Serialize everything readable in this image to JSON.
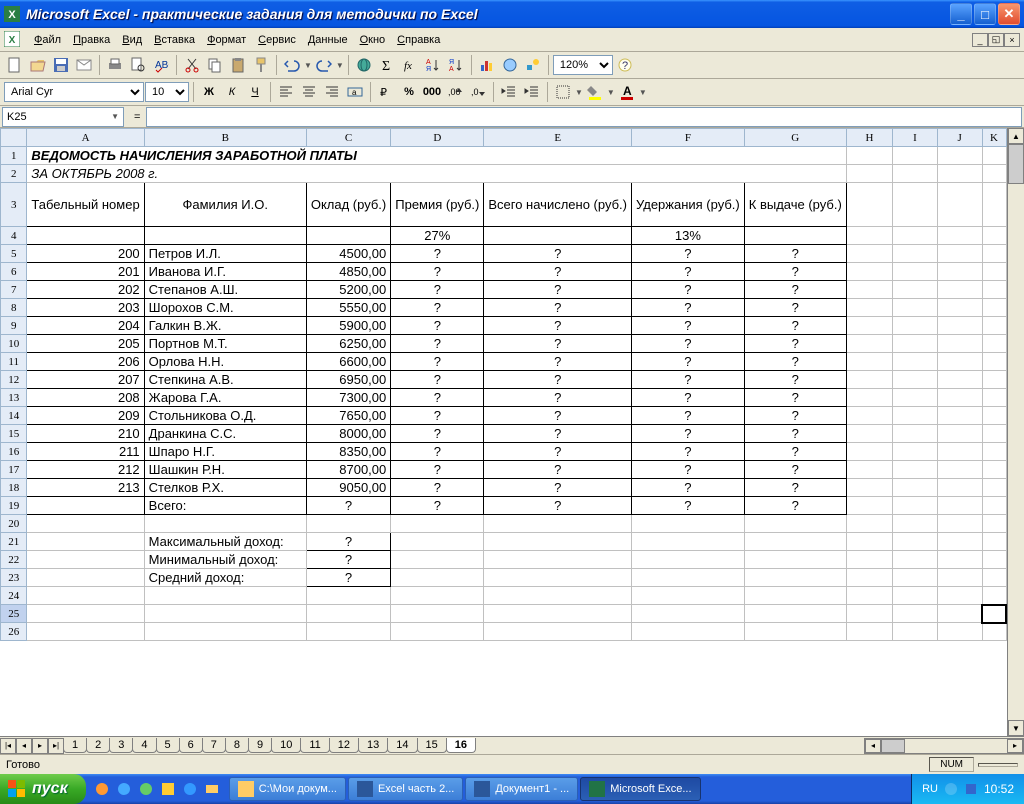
{
  "window": {
    "title": "Microsoft Excel - практические задания для методички по Excel"
  },
  "menu": [
    "Файл",
    "Правка",
    "Вид",
    "Вставка",
    "Формат",
    "Сервис",
    "Данные",
    "Окно",
    "Справка"
  ],
  "zoom": "120%",
  "font": {
    "name": "Arial Cyr",
    "size": "10"
  },
  "namebox": "K25",
  "formula": "",
  "columns": [
    "A",
    "B",
    "C",
    "D",
    "E",
    "F",
    "G",
    "H",
    "I",
    "J",
    "K"
  ],
  "sheet": {
    "title": "ВЕДОМОСТЬ НАЧИСЛЕНИЯ ЗАРАБОТНОЙ ПЛАТЫ",
    "subtitle": "ЗА ОКТЯБРЬ 2008 г.",
    "headers": [
      "Табельный номер",
      "Фамилия И.О.",
      "Оклад (руб.)",
      "Премия (руб.)",
      "Всего начислено (руб.)",
      "Удержания (руб.)",
      "К выдаче (руб.)"
    ],
    "percents": {
      "premium": "27%",
      "deduct": "13%"
    },
    "rows": [
      {
        "n": "200",
        "name": "Петров И.Л.",
        "salary": "4500,00"
      },
      {
        "n": "201",
        "name": "Иванова И.Г.",
        "salary": "4850,00"
      },
      {
        "n": "202",
        "name": "Степанов А.Ш.",
        "salary": "5200,00"
      },
      {
        "n": "203",
        "name": "Шорохов С.М.",
        "salary": "5550,00"
      },
      {
        "n": "204",
        "name": "Галкин В.Ж.",
        "salary": "5900,00"
      },
      {
        "n": "205",
        "name": "Портнов М.Т.",
        "salary": "6250,00"
      },
      {
        "n": "206",
        "name": "Орлова Н.Н.",
        "salary": "6600,00"
      },
      {
        "n": "207",
        "name": "Степкина А.В.",
        "salary": "6950,00"
      },
      {
        "n": "208",
        "name": "Жарова Г.А.",
        "salary": "7300,00"
      },
      {
        "n": "209",
        "name": "Стольникова О.Д.",
        "salary": "7650,00"
      },
      {
        "n": "210",
        "name": "Дранкина С.С.",
        "salary": "8000,00"
      },
      {
        "n": "211",
        "name": "Шпаро Н.Г.",
        "salary": "8350,00"
      },
      {
        "n": "212",
        "name": "Шашкин Р.Н.",
        "salary": "8700,00"
      },
      {
        "n": "213",
        "name": "Стелков Р.Х.",
        "salary": "9050,00"
      }
    ],
    "q": "?",
    "total_label": "Всего:",
    "summary": {
      "max": "Максимальный доход:",
      "min": "Минимальный доход:",
      "avg": "Средний доход:"
    }
  },
  "tabs": [
    "1",
    "2",
    "3",
    "4",
    "5",
    "6",
    "7",
    "8",
    "9",
    "10",
    "11",
    "12",
    "13",
    "14",
    "15",
    "16"
  ],
  "active_tab": "16",
  "status": "Готово",
  "status_num": "NUM",
  "taskbar": {
    "start": "пуск",
    "items": [
      {
        "icon": "folder",
        "label": "C:\\Мои докум..."
      },
      {
        "icon": "word",
        "label": "Excel часть 2..."
      },
      {
        "icon": "word",
        "label": "Документ1 - ..."
      },
      {
        "icon": "excel",
        "label": "Microsoft Exce...",
        "active": true
      }
    ],
    "lang": "RU",
    "clock": "10:52"
  }
}
